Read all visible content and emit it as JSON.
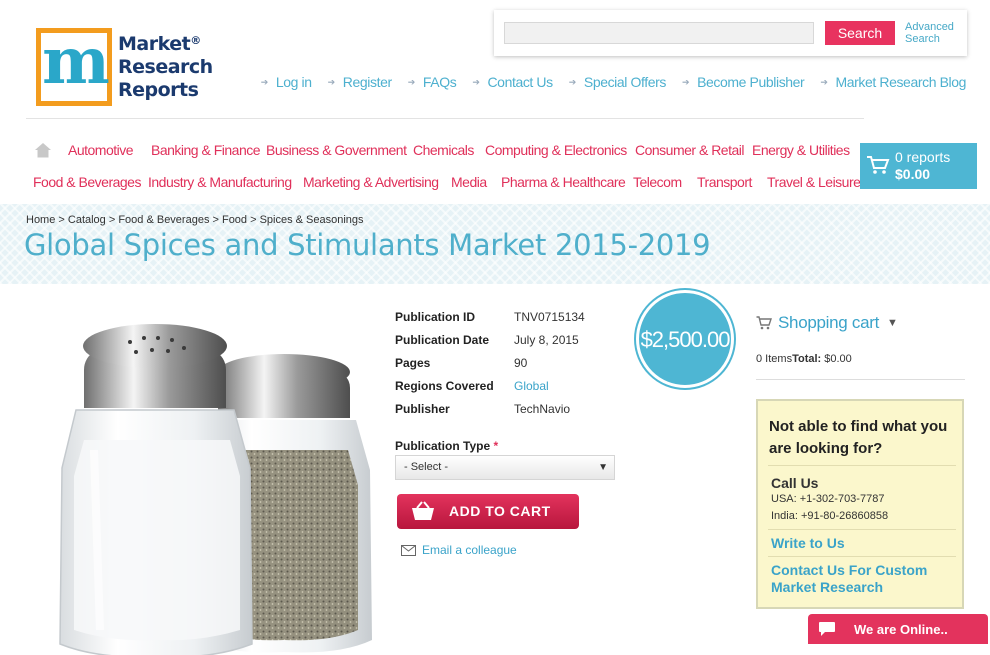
{
  "logo": {
    "line1": "Market",
    "line2": "Research",
    "line3": "Reports",
    "reg": "®"
  },
  "search": {
    "placeholder": "",
    "button": "Search",
    "advanced_line1": "Advanced",
    "advanced_line2": "Search"
  },
  "top_links": [
    "Log in",
    "Register",
    "FAQs",
    "Contact Us",
    "Special Offers",
    "Become Publisher",
    "Market Research Blog"
  ],
  "nav_row1": [
    "Automotive",
    "Banking & Finance",
    "Business & Government",
    "Chemicals",
    "Computing & Electronics",
    "Consumer & Retail",
    "Energy & Utilities"
  ],
  "nav_row2": [
    "Food & Beverages",
    "Industry & Manufacturing",
    "Marketing & Advertising",
    "Media",
    "Pharma & Healthcare",
    "Telecom",
    "Transport",
    "Travel & Leisure"
  ],
  "cart": {
    "count": "0 reports",
    "total": "$0.00"
  },
  "breadcrumb": "Home > Catalog > Food & Beverages > Food > Spices & Seasonings",
  "title": "Global Spices and Stimulants Market 2015-2019",
  "details": [
    {
      "label": "Publication ID",
      "value": "TNV0715134"
    },
    {
      "label": "Publication Date",
      "value": "July 8, 2015"
    },
    {
      "label": "Pages",
      "value": "90"
    },
    {
      "label": "Regions Covered",
      "value": "Global"
    },
    {
      "label": "Publisher",
      "value": "TechNavio"
    }
  ],
  "publication_type": {
    "label": "Publication Type",
    "required": "*",
    "selected": "- Select -"
  },
  "add_to_cart": "ADD TO CART",
  "email_colleague": "Email a colleague",
  "price": "$2,500.00",
  "shopping_cart": {
    "title": "Shopping cart",
    "items_label": "0 Items",
    "total_label": "Total:",
    "total_value": "$0.00"
  },
  "help": {
    "heading": "Not able to find what you are looking for?",
    "call_us": "Call Us",
    "usa": "USA: +1-302-703-7787",
    "india": "India: +91-80-26860858",
    "write": "Write to Us",
    "custom": "Contact Us For Custom Market Research"
  },
  "online": "We are Online..",
  "colors": {
    "accent_pink": "#e0305a",
    "accent_blue": "#4eb6d3",
    "logo_orange": "#f39c1e"
  }
}
